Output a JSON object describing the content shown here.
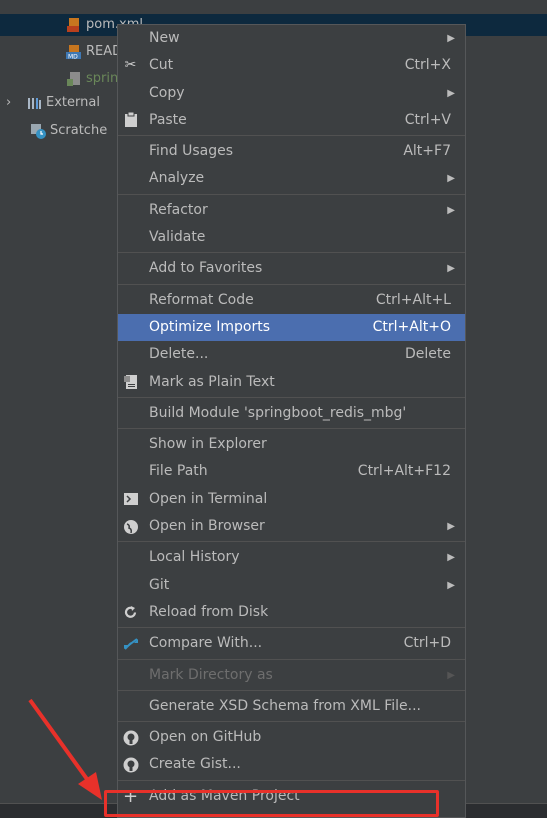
{
  "project_tree": {
    "items": [
      {
        "label": "pom.xml"
      },
      {
        "label": "READ"
      },
      {
        "label": "spring"
      },
      {
        "label": "External"
      },
      {
        "label": "Scratche"
      }
    ]
  },
  "context_menu": {
    "new": {
      "label": "New"
    },
    "cut": {
      "label": "Cut",
      "shortcut": "Ctrl+X"
    },
    "copy": {
      "label": "Copy"
    },
    "paste": {
      "label": "Paste",
      "shortcut": "Ctrl+V"
    },
    "find_usages": {
      "label": "Find Usages",
      "shortcut": "Alt+F7"
    },
    "analyze": {
      "label": "Analyze"
    },
    "refactor": {
      "label": "Refactor"
    },
    "validate": {
      "label": "Validate"
    },
    "add_to_favorites": {
      "label": "Add to Favorites"
    },
    "reformat_code": {
      "label": "Reformat Code",
      "shortcut": "Ctrl+Alt+L"
    },
    "optimize_imports": {
      "label": "Optimize Imports",
      "shortcut": "Ctrl+Alt+O"
    },
    "delete": {
      "label": "Delete...",
      "shortcut": "Delete"
    },
    "mark_plain_text": {
      "label": "Mark as Plain Text"
    },
    "build_module": {
      "label": "Build Module 'springboot_redis_mbg'"
    },
    "show_in_explorer": {
      "label": "Show in Explorer"
    },
    "file_path": {
      "label": "File Path",
      "shortcut": "Ctrl+Alt+F12"
    },
    "open_in_terminal": {
      "label": "Open in Terminal"
    },
    "open_in_browser": {
      "label": "Open in Browser"
    },
    "local_history": {
      "label": "Local History"
    },
    "git": {
      "label": "Git"
    },
    "reload_from_disk": {
      "label": "Reload from Disk"
    },
    "compare_with": {
      "label": "Compare With...",
      "shortcut": "Ctrl+D"
    },
    "mark_directory_as": {
      "label": "Mark Directory as"
    },
    "generate_xsd": {
      "label": "Generate XSD Schema from XML File..."
    },
    "open_on_github": {
      "label": "Open on GitHub"
    },
    "create_gist": {
      "label": "Create Gist..."
    },
    "add_as_maven": {
      "label": "Add as Maven Project"
    }
  },
  "colors": {
    "highlight": "#4b6eaf",
    "annotation": "#e8312a",
    "background": "#3c3f41"
  }
}
